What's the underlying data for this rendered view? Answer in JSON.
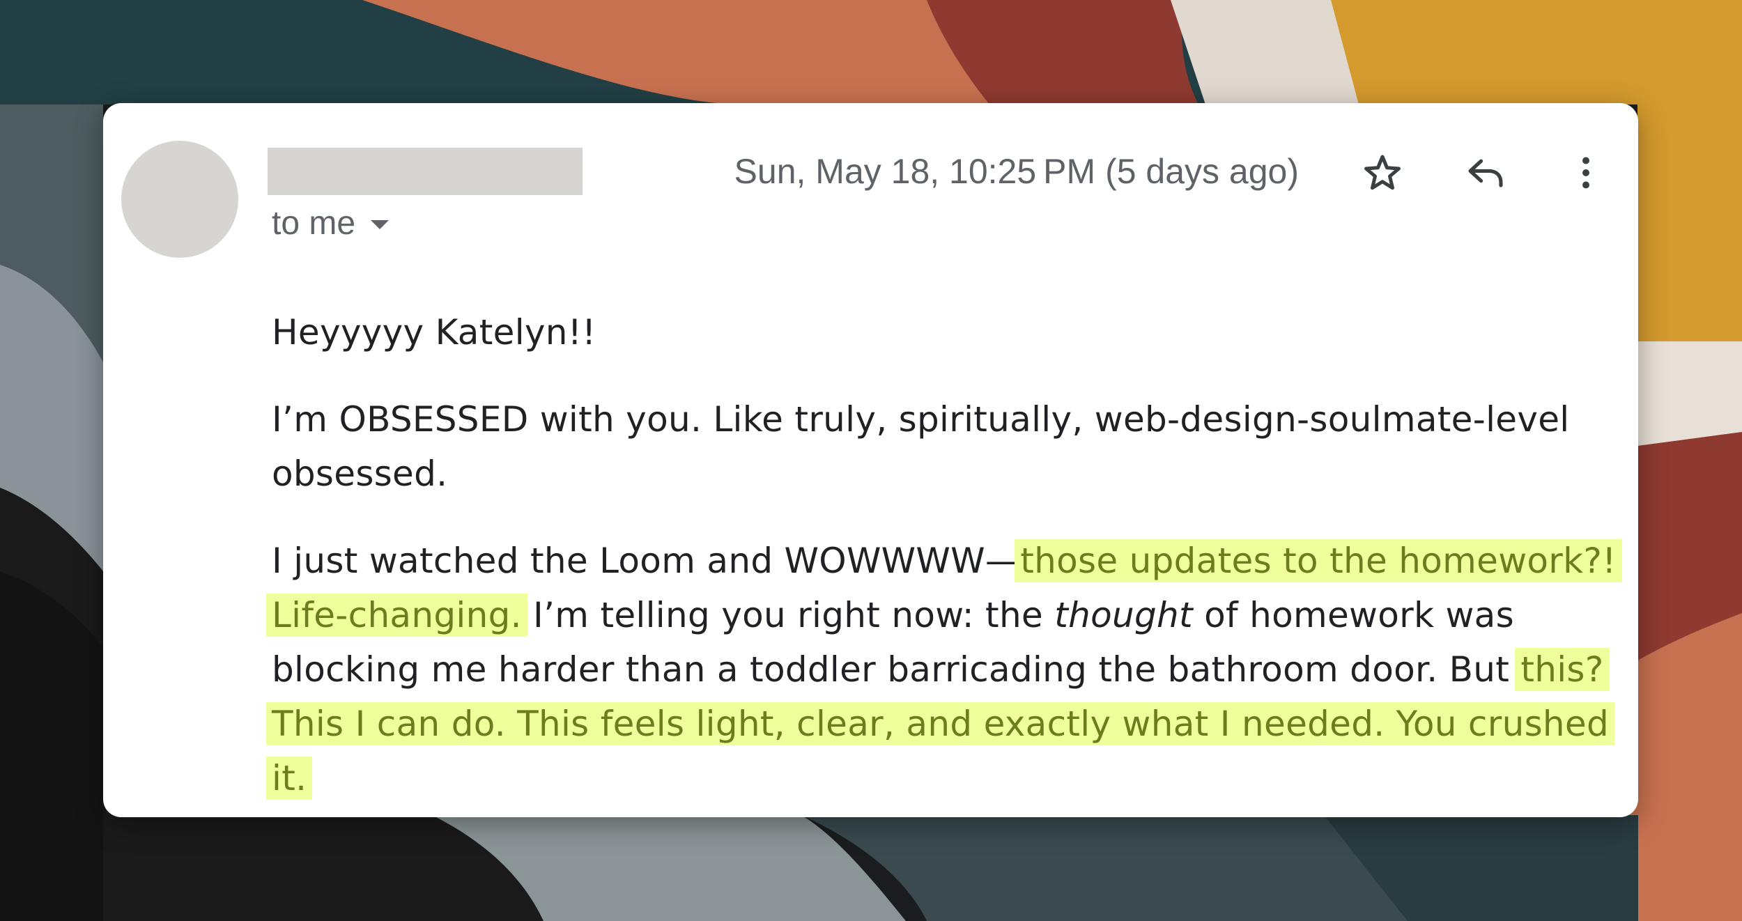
{
  "email": {
    "sender_redacted": true,
    "recipient_label": "to me",
    "date": "Sun, May 18, 10:25 PM (5 days ago)",
    "icons": {
      "star": "star-icon",
      "reply": "reply-icon",
      "more": "more-vert-icon",
      "recipient_dropdown": "caret-down-icon"
    },
    "body": {
      "greeting": "Heyyyyy Katelyn!!",
      "p2": "I’m OBSESSED with you. Like truly, spiritually, web-design-soulmate-level obsessed.",
      "p3_a": "I just watched the Loom and WOWWWW—",
      "p3_h1": "those updates to the homework?! Life-changing.",
      "p3_b": " I’m telling you right now: the ",
      "p3_em": "thought",
      "p3_c": " of homework was blocking me harder than a toddler barricading the bathroom door. But ",
      "p3_h2": "this? This I can do. This feels light, clear, and exactly what I needed. You crushed it."
    }
  },
  "colors": {
    "highlight_bg": "#efff9b",
    "highlight_text": "#6e7c1f",
    "meta_text": "#5f6368",
    "body_text": "#202124",
    "placeholder": "#d7d5d1"
  }
}
